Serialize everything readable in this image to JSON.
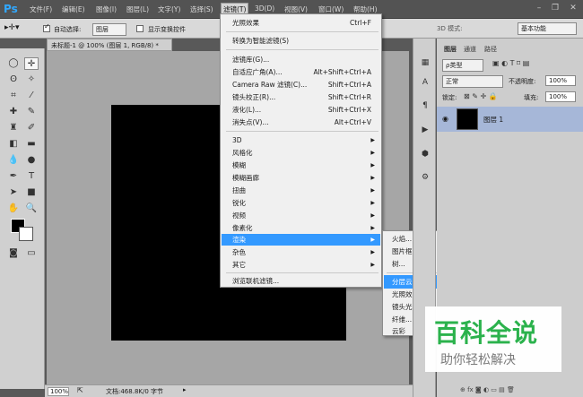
{
  "app": {
    "logo": "Ps"
  },
  "menubar": {
    "items": [
      "文件(F)",
      "编辑(E)",
      "图像(I)",
      "图层(L)",
      "文字(Y)",
      "选择(S)",
      "滤镜(T)",
      "3D(D)",
      "视图(V)",
      "窗口(W)",
      "帮助(H)"
    ],
    "active": "滤镜(T)"
  },
  "options_bar": {
    "auto_select_label": "自动选择:",
    "auto_select_value": "图层",
    "show_transform_label": "显示变换控件",
    "mode_3d_label": "3D 模式:",
    "workspace": "基本功能"
  },
  "document": {
    "tab_title": "未标题-1 @ 100% (图层 1, RGB/8) *",
    "canvas_color": "#000000"
  },
  "status_bar": {
    "zoom": "100%",
    "doc_info": "文档:468.8K/0 字节"
  },
  "filter_menu": {
    "items": [
      {
        "label": "光照效果",
        "shortcut": "Ctrl+F"
      },
      {
        "separator": true
      },
      {
        "label": "转换为智能滤镜(S)"
      },
      {
        "separator": true
      },
      {
        "label": "滤镜库(G)..."
      },
      {
        "label": "自适应广角(A)...",
        "shortcut": "Alt+Shift+Ctrl+A"
      },
      {
        "label": "Camera Raw 滤镜(C)...",
        "shortcut": "Shift+Ctrl+A"
      },
      {
        "label": "镜头校正(R)...",
        "shortcut": "Shift+Ctrl+R"
      },
      {
        "label": "液化(L)...",
        "shortcut": "Shift+Ctrl+X"
      },
      {
        "label": "消失点(V)...",
        "shortcut": "Alt+Ctrl+V"
      },
      {
        "separator": true
      },
      {
        "label": "3D",
        "submenu": true
      },
      {
        "label": "风格化",
        "submenu": true
      },
      {
        "label": "模糊",
        "submenu": true
      },
      {
        "label": "模糊画廊",
        "submenu": true
      },
      {
        "label": "扭曲",
        "submenu": true
      },
      {
        "label": "锐化",
        "submenu": true
      },
      {
        "label": "视频",
        "submenu": true
      },
      {
        "label": "像素化",
        "submenu": true
      },
      {
        "label": "渲染",
        "submenu": true,
        "highlighted": true
      },
      {
        "label": "杂色",
        "submenu": true
      },
      {
        "label": "其它",
        "submenu": true
      },
      {
        "separator": true
      },
      {
        "label": "浏览联机滤镜..."
      }
    ]
  },
  "render_submenu": {
    "items": [
      {
        "label": "火焰..."
      },
      {
        "label": "图片框..."
      },
      {
        "label": "树..."
      },
      {
        "separator": true
      },
      {
        "label": "分层云彩",
        "highlighted": true
      },
      {
        "label": "光照效果..."
      },
      {
        "label": "镜头光晕..."
      },
      {
        "label": "纤维..."
      },
      {
        "label": "云彩"
      }
    ]
  },
  "layers_panel": {
    "tabs": [
      "图层",
      "通道",
      "路径"
    ],
    "kind_filter": "ρ类型",
    "blend_mode": "正常",
    "opacity_label": "不透明度:",
    "opacity_value": "100%",
    "lock_label": "锁定:",
    "fill_label": "填充:",
    "fill_value": "100%",
    "layer_name": "图层 1"
  },
  "watermark": {
    "title": "百科全说",
    "subtitle": "助你轻松解决",
    "title_color": "#2bb24c"
  }
}
